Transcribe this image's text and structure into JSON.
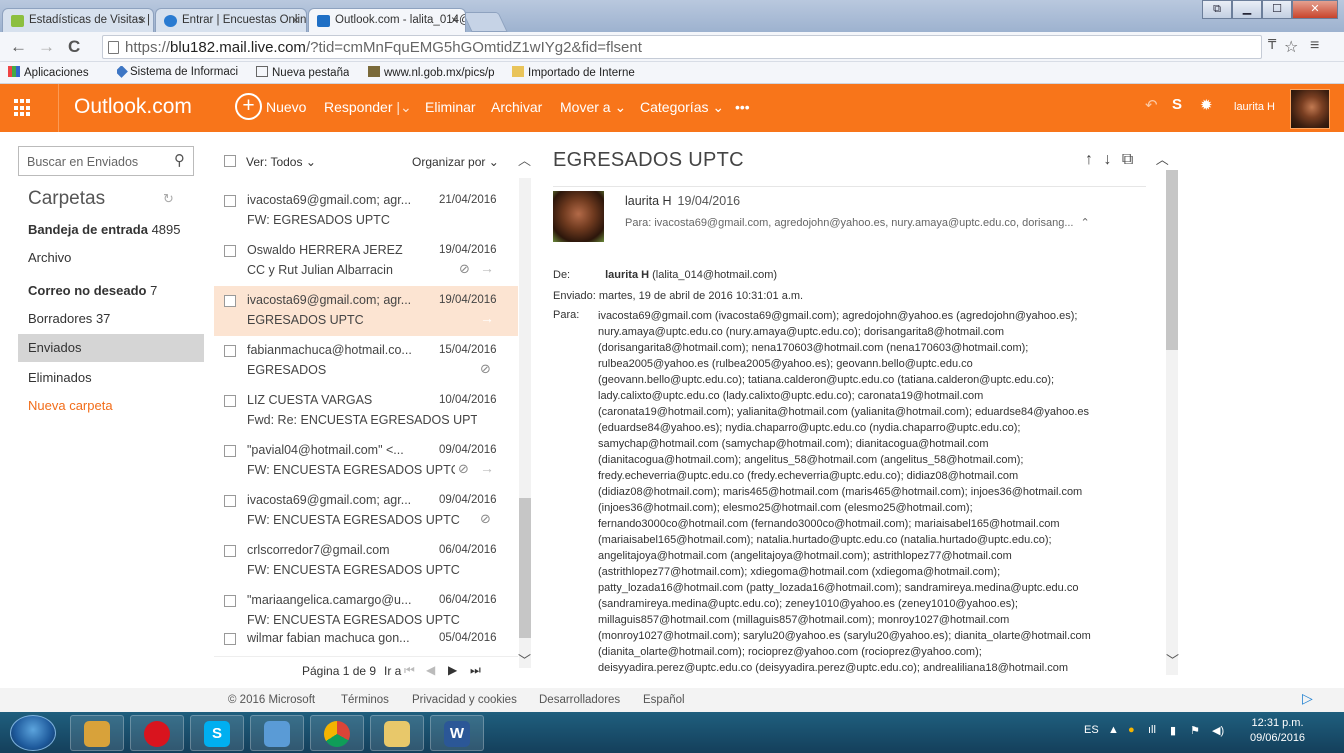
{
  "browser": {
    "tabs": [
      {
        "label": "Estadísticas de Visitas | Mi",
        "close": "×"
      },
      {
        "label": "Entrar | Encuestas Online |",
        "close": "×"
      },
      {
        "label": "Outlook.com - lalita_014@",
        "close": "×"
      }
    ],
    "address": {
      "prefix": "https://",
      "host": "blu182.mail.live.com",
      "path": "/?tid=cmMnFquEMG5hGOmtidZ1wIYg2&fid=flsent"
    },
    "bookmarks": [
      "Aplicaciones",
      "Sistema de Informaci",
      "Nueva pestaña",
      "www.nl.gob.mx/pics/p",
      "Importado de Interne"
    ]
  },
  "outlook": {
    "brand": "Outlook.com",
    "commands": {
      "new": "Nuevo",
      "reply": "Responder",
      "delete": "Eliminar",
      "archive": "Archivar",
      "move": "Mover a",
      "categories": "Categorías",
      "more": "•••"
    },
    "user": "laurita H"
  },
  "folders": {
    "search_placeholder": "Buscar en Enviados",
    "heading": "Carpetas",
    "items": [
      {
        "label": "Bandeja de entrada",
        "count": "4895"
      },
      {
        "label": "Archivo",
        "count": ""
      },
      {
        "label": "Correo no deseado",
        "count": "7"
      },
      {
        "label": "Borradores",
        "count": "37"
      },
      {
        "label": "Enviados",
        "count": ""
      },
      {
        "label": "Eliminados",
        "count": ""
      },
      {
        "label": "Nueva carpeta",
        "count": ""
      }
    ]
  },
  "list": {
    "view": "Ver: Todos",
    "sort": "Organizar por",
    "messages": [
      {
        "from": "ivacosta69@gmail.com; agr...",
        "date": "21/04/2016",
        "subject": "FW: EGRESADOS UPTC"
      },
      {
        "from": "Oswaldo HERRERA JEREZ",
        "date": "19/04/2016",
        "subject": "CC y Rut Julian Albarracin"
      },
      {
        "from": "ivacosta69@gmail.com; agr...",
        "date": "19/04/2016",
        "subject": "EGRESADOS UPTC"
      },
      {
        "from": "fabianmachuca@hotmail.co...",
        "date": "15/04/2016",
        "subject": "EGRESADOS"
      },
      {
        "from": "LIZ CUESTA VARGAS",
        "date": "10/04/2016",
        "subject": "Fwd: Re: ENCUESTA EGRESADOS UPTC"
      },
      {
        "from": "\"pavial04@hotmail.com\" <...",
        "date": "09/04/2016",
        "subject": "FW: ENCUESTA EGRESADOS UPTC"
      },
      {
        "from": "ivacosta69@gmail.com; agr...",
        "date": "09/04/2016",
        "subject": "FW: ENCUESTA EGRESADOS UPTC"
      },
      {
        "from": "crlscorredor7@gmail.com",
        "date": "06/04/2016",
        "subject": "FW: ENCUESTA EGRESADOS UPTC"
      },
      {
        "from": "\"mariaangelica.camargo@u...",
        "date": "06/04/2016",
        "subject": "FW: ENCUESTA EGRESADOS UPTC"
      },
      {
        "from": "wilmar fabian machuca gon...",
        "date": "05/04/2016",
        "subject": ""
      }
    ],
    "pager": {
      "page": "Página 1 de 9",
      "goto": "Ir a"
    }
  },
  "reading": {
    "title": "EGRESADOS UPTC",
    "sender": "laurita H",
    "date": "19/04/2016",
    "to_line": "Para: ivacosta69@gmail.com, agredojohn@yahoo.es, nury.amaya@uptc.edu.co, dorisang...",
    "de_label": "De:",
    "de_name": "laurita H",
    "de_addr": "(lalita_014@hotmail.com)",
    "enviado_label": "Enviado:",
    "enviado_value": "martes, 19 de abril de 2016 10:31:01 a.m.",
    "para_label": "Para:",
    "recipients": [
      "ivacosta69@gmail.com (ivacosta69@gmail.com); agredojohn@yahoo.es (agredojohn@yahoo.es);",
      "nury.amaya@uptc.edu.co (nury.amaya@uptc.edu.co); dorisangarita8@hotmail.com",
      "(dorisangarita8@hotmail.com); nena170603@hotmail.com (nena170603@hotmail.com);",
      "rulbea2005@yahoo.es (rulbea2005@yahoo.es); geovann.bello@uptc.edu.co",
      "(geovann.bello@uptc.edu.co); tatiana.calderon@uptc.edu.co (tatiana.calderon@uptc.edu.co);",
      "lady.calixto@uptc.edu.co (lady.calixto@uptc.edu.co); caronata19@hotmail.com",
      "(caronata19@hotmail.com); yalianita@hotmail.com (yalianita@hotmail.com); eduardse84@yahoo.es",
      "(eduardse84@yahoo.es); nydia.chaparro@uptc.edu.co (nydia.chaparro@uptc.edu.co);",
      "samychap@hotmail.com (samychap@hotmail.com); dianitacogua@hotmail.com",
      "(dianitacogua@hotmail.com); angelitus_58@hotmail.com (angelitus_58@hotmail.com);",
      "fredy.echeverria@uptc.edu.co (fredy.echeverria@uptc.edu.co); didiaz08@hotmail.com",
      "(didiaz08@hotmail.com); maris465@hotmail.com (maris465@hotmail.com); injoes36@hotmail.com",
      "(injoes36@hotmail.com); elesmo25@hotmail.com (elesmo25@hotmail.com);",
      "fernando3000co@hotmail.com (fernando3000co@hotmail.com); mariaisabel165@hotmail.com",
      "(mariaisabel165@hotmail.com); natalia.hurtado@uptc.edu.co (natalia.hurtado@uptc.edu.co);",
      "angelitajoya@hotmail.com (angelitajoya@hotmail.com); astrithlopez77@hotmail.com",
      "(astrithlopez77@hotmail.com); xdiegoma@hotmail.com (xdiegoma@hotmail.com);",
      "patty_lozada16@hotmail.com (patty_lozada16@hotmail.com); sandramireya.medina@uptc.edu.co",
      "(sandramireya.medina@uptc.edu.co); zeney1010@yahoo.es (zeney1010@yahoo.es);",
      "millaguis857@hotmail.com (millaguis857@hotmail.com); monroy1027@hotmail.com",
      "(monroy1027@hotmail.com); sarylu20@yahoo.es (sarylu20@yahoo.es); dianita_olarte@hotmail.com",
      "(dianita_olarte@hotmail.com); rocioprez@yahoo.com (rocioprez@yahoo.com);",
      "deisyyadira.perez@uptc.edu.co (deisyyadira.perez@uptc.edu.co); andrealiliana18@hotmail.com"
    ]
  },
  "footer": [
    "© 2016 Microsoft",
    "Términos",
    "Privacidad y cookies",
    "Desarrolladores",
    "Español"
  ],
  "taskbar": {
    "lang": "ES",
    "time": "12:31 p.m.",
    "date": "09/06/2016"
  },
  "colors": {
    "brand": "#f8751a",
    "selected_row": "#fce4d2",
    "selected_folder": "#d5d5d5",
    "new_folder": "#f26d1a"
  }
}
